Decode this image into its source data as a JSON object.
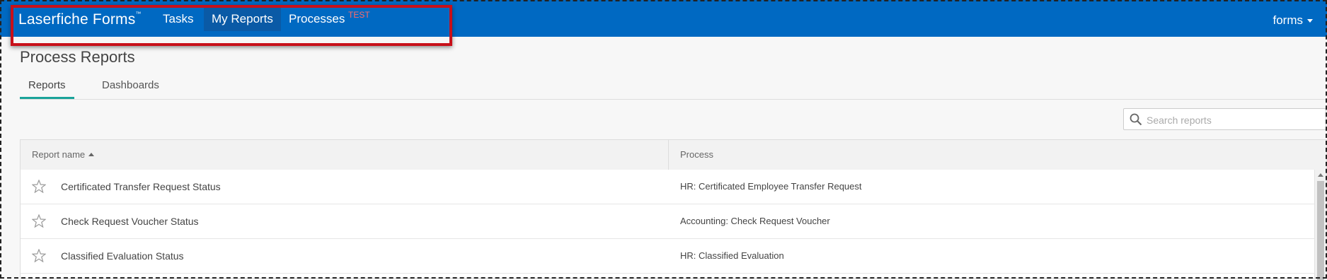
{
  "header": {
    "brand": "Laserfiche Forms",
    "brand_tm": "™",
    "nav": [
      {
        "label": "Tasks",
        "active": false
      },
      {
        "label": "My Reports",
        "active": true
      },
      {
        "label": "Processes",
        "active": false
      }
    ],
    "env_tag": "TEST",
    "user": "forms"
  },
  "page": {
    "title": "Process Reports",
    "tabs": [
      {
        "label": "Reports",
        "active": true
      },
      {
        "label": "Dashboards",
        "active": false
      }
    ]
  },
  "search": {
    "placeholder": "Search reports",
    "value": ""
  },
  "table": {
    "columns": [
      "Report name",
      "Process"
    ],
    "sort": {
      "column": "Report name",
      "direction": "ascending"
    },
    "rows": [
      {
        "name": "Certificated Transfer Request Status",
        "process": "HR: Certificated Employee Transfer Request",
        "starred": false
      },
      {
        "name": "Check Request Voucher Status",
        "process": "Accounting: Check Request Voucher",
        "starred": false
      },
      {
        "name": "Classified Evaluation Status",
        "process": "HR: Classified Evaluation",
        "starred": false
      }
    ]
  },
  "colors": {
    "header_bg": "#0069c2",
    "active_nav_bg": "#0a5aa6",
    "highlight_border": "#c8101a",
    "test_tag": "#ff6a6a",
    "tab_underline": "#1aa39a"
  },
  "icons": {
    "search": "search-icon",
    "star": "star-outline-icon",
    "sort": "sort-ascending-icon",
    "user_caret": "caret-down-icon"
  }
}
